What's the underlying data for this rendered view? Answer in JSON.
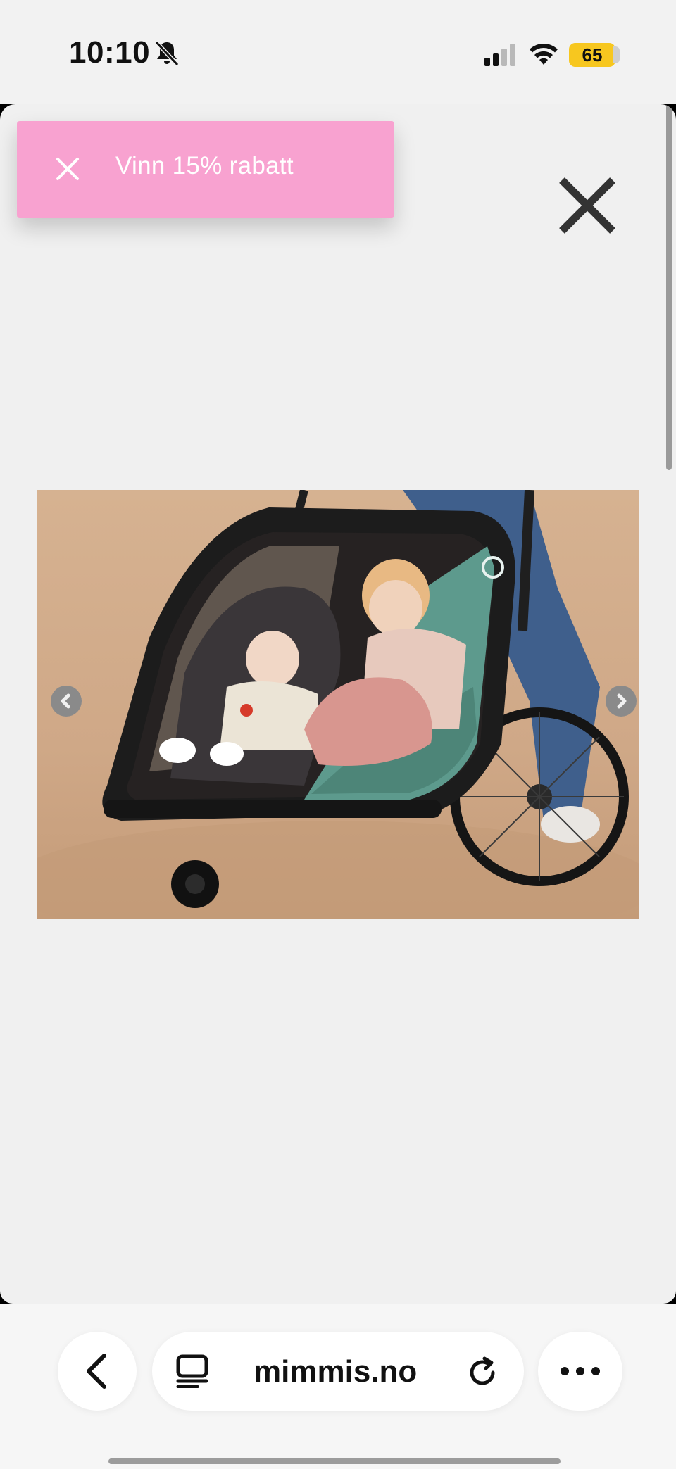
{
  "status_bar": {
    "time": "10:10",
    "battery": "65",
    "icons": [
      "bell-slash-icon",
      "signal-icon",
      "wifi-icon",
      "battery-icon"
    ]
  },
  "promo": {
    "text": "Vinn 15% rabatt",
    "background_color": "#f8a2d0"
  },
  "modal": {
    "close_icon": "close-icon",
    "image": "stroller-photo",
    "nav": [
      "chevron-left-icon",
      "chevron-right-icon"
    ]
  },
  "browser": {
    "url": "mimmis.no",
    "icons": [
      "chevron-left-icon",
      "reader-icon",
      "reload-icon",
      "more-icon"
    ]
  }
}
